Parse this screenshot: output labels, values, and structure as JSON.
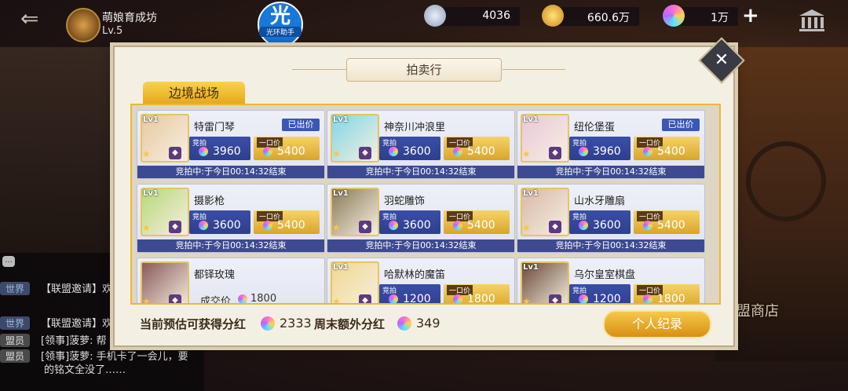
{
  "topbar": {
    "guild_name": "萌娘育成坊",
    "guild_level": "Lv.5",
    "helper_big": "光",
    "helper_small": "光环助手",
    "silver": "4036",
    "gold": "660.6万",
    "gems": "1万",
    "plus_label": "+"
  },
  "background": {
    "alliance_shop": "盟商店"
  },
  "chat": {
    "lines": [
      {
        "tag": "世界",
        "text": "【联盟邀请】欢"
      },
      {
        "tag": "世界",
        "text": "【联盟邀请】欢"
      },
      {
        "tag": "盟员",
        "text": "[领事]菠萝: 帮"
      },
      {
        "tag": "盟员",
        "text": "[领事]菠萝: 手机卡了一会儿，要"
      },
      {
        "tag": "",
        "text": "的铭文全没了……"
      }
    ]
  },
  "auction": {
    "title": "拍卖行",
    "tab": "边境战场",
    "close": "✕",
    "labels": {
      "bid": "竞拍",
      "buyout": "一口价",
      "sold": "已出价",
      "reserve": "成交价"
    },
    "items": [
      {
        "name": "特雷门琴",
        "lv": "Lv1",
        "bid": "3960",
        "buyout": "5400",
        "sold": true,
        "timer": "竞拍中:于今日00:14:32结束",
        "color": "#e8c8a0"
      },
      {
        "name": "神奈川冲浪里",
        "lv": "Lv1",
        "bid": "3600",
        "buyout": "5400",
        "sold": false,
        "timer": "竞拍中:于今日00:14:32结束",
        "color": "#7fd6e8"
      },
      {
        "name": "纽伦堡蛋",
        "lv": "Lv1",
        "bid": "3960",
        "buyout": "5400",
        "sold": true,
        "timer": "竞拍中:于今日00:14:32结束",
        "color": "#e9c8d8"
      },
      {
        "name": "摄影枪",
        "lv": "Lv1",
        "bid": "3600",
        "buyout": "5400",
        "sold": false,
        "timer": "竞拍中:于今日00:14:32结束",
        "color": "#b8d878"
      },
      {
        "name": "羽蛇雕饰",
        "lv": "Lv1",
        "bid": "3600",
        "buyout": "5400",
        "sold": false,
        "timer": "竞拍中:于今日00:14:32结束",
        "color": "#8a7a5a"
      },
      {
        "name": "山水牙雕扇",
        "lv": "Lv1",
        "bid": "3600",
        "buyout": "5400",
        "sold": false,
        "timer": "竞拍中:于今日00:14:32结束",
        "color": "#d8b8a8"
      },
      {
        "name": "都铎玫瑰",
        "lv": "",
        "bid": "",
        "buyout": "",
        "sold": false,
        "timer": "",
        "reserve": "1800",
        "color": "#8a5a5a"
      },
      {
        "name": "哈默林的魔笛",
        "lv": "Lv1",
        "bid": "1200",
        "buyout": "1800",
        "sold": false,
        "timer": "",
        "color": "#f0d890"
      },
      {
        "name": "乌尔皇室棋盘",
        "lv": "Lv1",
        "bid": "1200",
        "buyout": "1800",
        "sold": false,
        "timer": "",
        "color": "#6a4a3a"
      }
    ]
  },
  "footer": {
    "estimate_label": "当前预估可获得分红",
    "estimate_value": "2333",
    "weekend_label": "周末额外分红",
    "weekend_value": "349",
    "record_button": "个人纪录"
  }
}
